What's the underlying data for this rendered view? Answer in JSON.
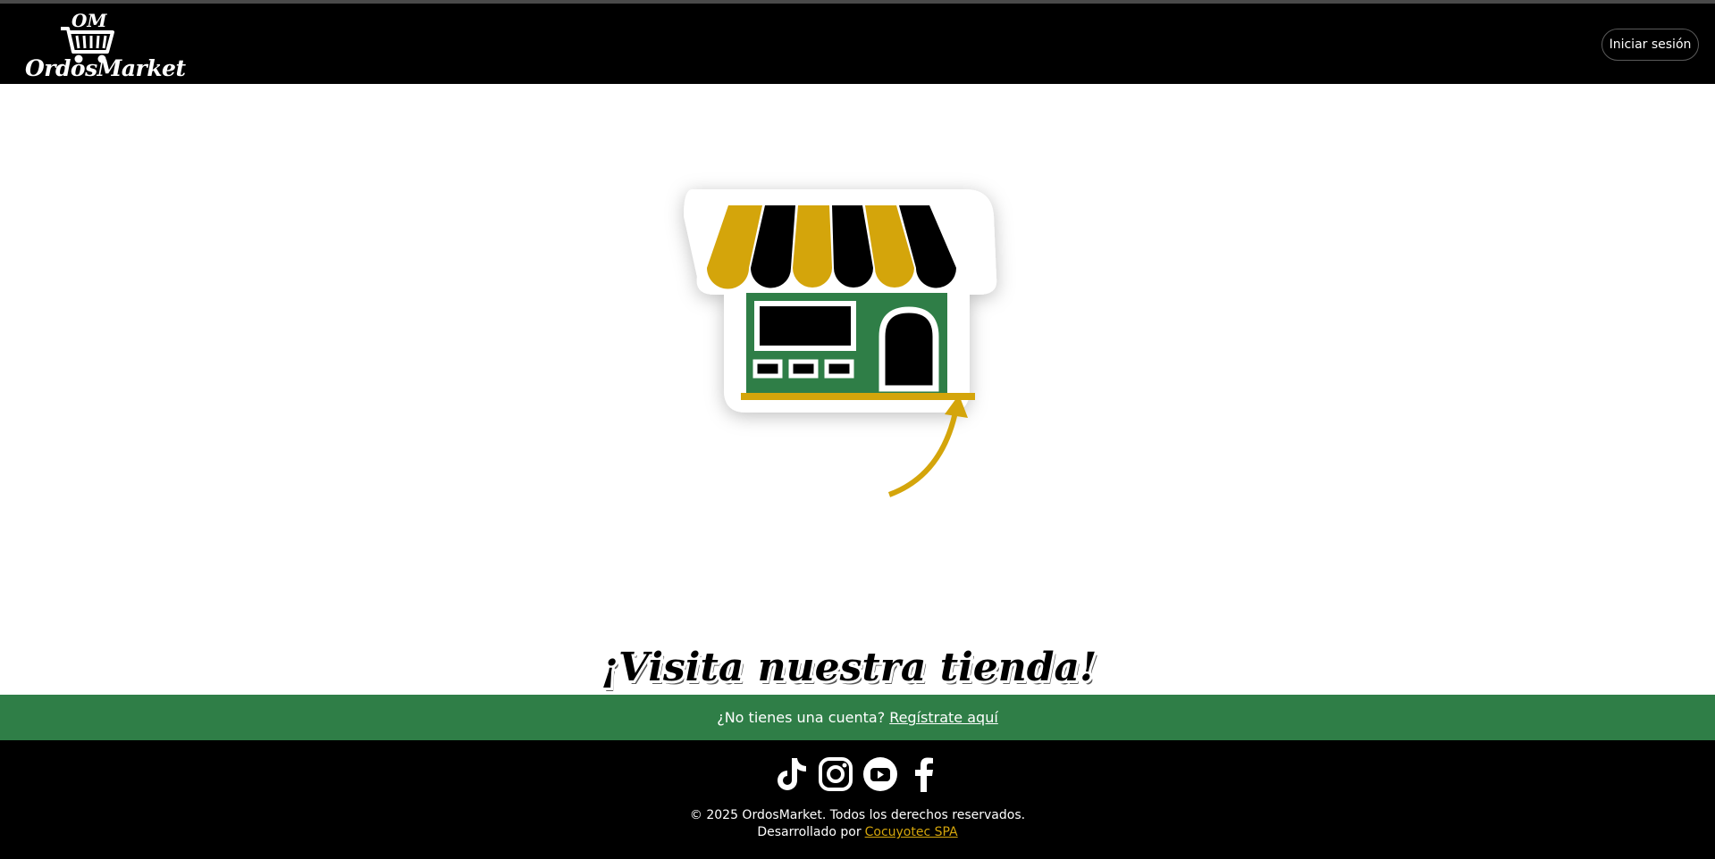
{
  "header": {
    "logo_monogram": "OM",
    "logo_text": "OrdosMarket",
    "login_label": "Iniciar sesión"
  },
  "hero": {
    "cta_text": "¡Visita nuestra tienda!",
    "colors": {
      "awning_yellow": "#d4a50b",
      "storefront_green": "#2f7e47",
      "black": "#000000"
    }
  },
  "register": {
    "prompt": "¿No tienes una cuenta?",
    "link_label": "Regístrate aquí"
  },
  "footer": {
    "socials": [
      {
        "name": "tiktok-icon"
      },
      {
        "name": "instagram-icon"
      },
      {
        "name": "youtube-icon"
      },
      {
        "name": "facebook-icon"
      }
    ],
    "copyright": "© 2025 OrdosMarket. Todos los derechos reservados.",
    "developed_by": "Desarrollado por",
    "developer_link": "Cocuyotec SPA",
    "accent": "#d4a50b"
  }
}
